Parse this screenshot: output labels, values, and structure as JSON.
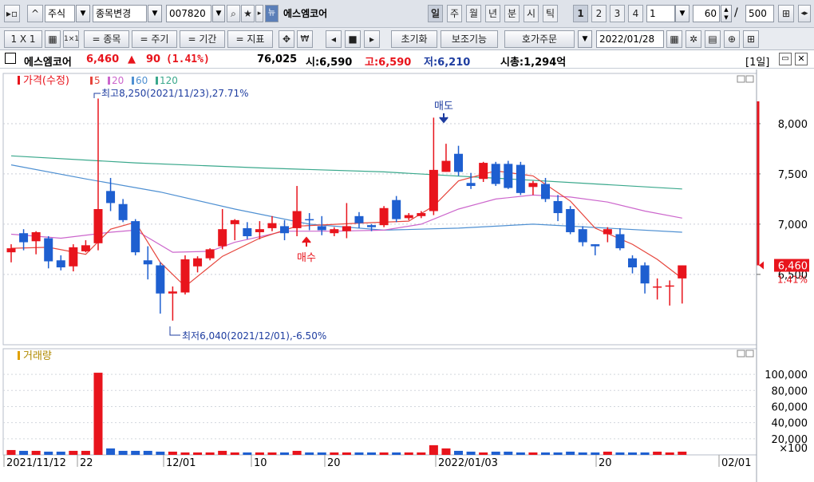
{
  "toolbar1": {
    "market": "주식",
    "change_btn": "종목변경",
    "code": "007820",
    "name": "에스엠코어",
    "periods": [
      "일",
      "주",
      "월",
      "년",
      "분",
      "시",
      "틱"
    ],
    "active_period": "일",
    "multiples": [
      "1",
      "2",
      "3",
      "4"
    ],
    "count_field": "1",
    "count": "60",
    "total": "500",
    "slash": "/"
  },
  "toolbar2": {
    "layout": "1 X 1",
    "stock_btn": "= 종목",
    "cycle_btn": "= 주기",
    "term_btn": "= 기간",
    "indicator_btn": "= 지표",
    "reset": "초기화",
    "aux": "보조기능",
    "quote": "호가주문",
    "date": "2022/01/28"
  },
  "info": {
    "name": "에스엠코어",
    "price": "6,460",
    "change_sign": "▲",
    "change": "90",
    "change_pct": "(1.41%)",
    "volume": "76,025",
    "open": "시:6,590",
    "high": "고:6,590",
    "low": "저:6,210",
    "mcap": "시총:1,294억",
    "period_label": "[1일]"
  },
  "legend": {
    "price": "가격(수정)",
    "ma": [
      "5",
      "20",
      "60",
      "120"
    ],
    "volume": "거래량"
  },
  "annotations": {
    "high": "최고8,250(2021/11/23),27.71%",
    "low": "최저6,040(2021/12/01),-6.50%",
    "sell": "매도",
    "buy": "매수"
  },
  "last_label": {
    "price": "6,460",
    "pct": "1.41%"
  },
  "colors": {
    "up": "#e8141c",
    "down": "#1e5fd0",
    "ma5": "#e6453c",
    "ma20": "#cc66cc",
    "ma60": "#4f90d2",
    "ma120": "#3aa88c",
    "text_blue": "#1e3da0"
  },
  "chart_data": {
    "type": "candlestick",
    "title": "",
    "ylabel": "",
    "ylim": [
      5800,
      8500
    ],
    "yticks": [
      8000,
      7500,
      7000,
      6500
    ],
    "x_labels": [
      "2021/11/12",
      "22",
      "12/01",
      "10",
      "20",
      "2022/01/03",
      "20",
      "02/01"
    ],
    "candles": [
      {
        "o": 6720,
        "h": 6800,
        "l": 6620,
        "c": 6760
      },
      {
        "o": 6910,
        "h": 6950,
        "l": 6740,
        "c": 6820
      },
      {
        "o": 6830,
        "h": 6930,
        "l": 6700,
        "c": 6920
      },
      {
        "o": 6860,
        "h": 6880,
        "l": 6560,
        "c": 6630
      },
      {
        "o": 6640,
        "h": 6690,
        "l": 6540,
        "c": 6570
      },
      {
        "o": 6580,
        "h": 6800,
        "l": 6530,
        "c": 6770
      },
      {
        "o": 6730,
        "h": 6840,
        "l": 6720,
        "c": 6790
      },
      {
        "o": 6810,
        "h": 8250,
        "l": 6740,
        "c": 7150
      },
      {
        "o": 7330,
        "h": 7460,
        "l": 7130,
        "c": 7210
      },
      {
        "o": 7200,
        "h": 7250,
        "l": 7020,
        "c": 7040
      },
      {
        "o": 7030,
        "h": 7050,
        "l": 6690,
        "c": 6720
      },
      {
        "o": 6640,
        "h": 6780,
        "l": 6450,
        "c": 6600
      },
      {
        "o": 6590,
        "h": 6620,
        "l": 6110,
        "c": 6310
      },
      {
        "o": 6310,
        "h": 6380,
        "l": 6040,
        "c": 6330
      },
      {
        "o": 6320,
        "h": 6690,
        "l": 6300,
        "c": 6650
      },
      {
        "o": 6580,
        "h": 6680,
        "l": 6520,
        "c": 6660
      },
      {
        "o": 6660,
        "h": 6760,
        "l": 6640,
        "c": 6750
      },
      {
        "o": 6780,
        "h": 7150,
        "l": 6750,
        "c": 6950
      },
      {
        "o": 7000,
        "h": 7050,
        "l": 6840,
        "c": 7040
      },
      {
        "o": 6960,
        "h": 7020,
        "l": 6850,
        "c": 6880
      },
      {
        "o": 6920,
        "h": 7030,
        "l": 6850,
        "c": 6950
      },
      {
        "o": 6960,
        "h": 7080,
        "l": 6930,
        "c": 7010
      },
      {
        "o": 6980,
        "h": 7040,
        "l": 6840,
        "c": 6910
      },
      {
        "o": 6960,
        "h": 7380,
        "l": 6880,
        "c": 7130
      },
      {
        "o": 7050,
        "h": 7110,
        "l": 6940,
        "c": 7040
      },
      {
        "o": 6980,
        "h": 7080,
        "l": 6890,
        "c": 6940
      },
      {
        "o": 6910,
        "h": 6970,
        "l": 6880,
        "c": 6950
      },
      {
        "o": 6930,
        "h": 7210,
        "l": 6860,
        "c": 6980
      },
      {
        "o": 7080,
        "h": 7120,
        "l": 6960,
        "c": 7010
      },
      {
        "o": 6990,
        "h": 7000,
        "l": 6930,
        "c": 6970
      },
      {
        "o": 6990,
        "h": 7180,
        "l": 6970,
        "c": 7160
      },
      {
        "o": 7240,
        "h": 7280,
        "l": 7020,
        "c": 7050
      },
      {
        "o": 7060,
        "h": 7110,
        "l": 7040,
        "c": 7090
      },
      {
        "o": 7080,
        "h": 7130,
        "l": 7060,
        "c": 7110
      },
      {
        "o": 7130,
        "h": 8060,
        "l": 7090,
        "c": 7540
      },
      {
        "o": 7520,
        "h": 7800,
        "l": 7520,
        "c": 7630
      },
      {
        "o": 7700,
        "h": 7780,
        "l": 7480,
        "c": 7520
      },
      {
        "o": 7410,
        "h": 7510,
        "l": 7350,
        "c": 7380
      },
      {
        "o": 7450,
        "h": 7620,
        "l": 7420,
        "c": 7610
      },
      {
        "o": 7600,
        "h": 7620,
        "l": 7380,
        "c": 7400
      },
      {
        "o": 7600,
        "h": 7630,
        "l": 7350,
        "c": 7360
      },
      {
        "o": 7590,
        "h": 7620,
        "l": 7290,
        "c": 7310
      },
      {
        "o": 7370,
        "h": 7430,
        "l": 7290,
        "c": 7410
      },
      {
        "o": 7400,
        "h": 7460,
        "l": 7220,
        "c": 7250
      },
      {
        "o": 7230,
        "h": 7290,
        "l": 7030,
        "c": 7110
      },
      {
        "o": 7150,
        "h": 7180,
        "l": 6900,
        "c": 6920
      },
      {
        "o": 6950,
        "h": 6980,
        "l": 6780,
        "c": 6820
      },
      {
        "o": 6800,
        "h": 6800,
        "l": 6690,
        "c": 6780
      },
      {
        "o": 6900,
        "h": 6970,
        "l": 6820,
        "c": 6950
      },
      {
        "o": 6900,
        "h": 6960,
        "l": 6740,
        "c": 6760
      },
      {
        "o": 6660,
        "h": 6690,
        "l": 6510,
        "c": 6570
      },
      {
        "o": 6590,
        "h": 6620,
        "l": 6310,
        "c": 6410
      },
      {
        "o": 6370,
        "h": 6460,
        "l": 6250,
        "c": 6380
      },
      {
        "o": 6380,
        "h": 6440,
        "l": 6190,
        "c": 6390
      },
      {
        "o": 6460,
        "h": 6590,
        "l": 6210,
        "c": 6590
      }
    ],
    "ma5": [
      [
        0,
        6760
      ],
      [
        3,
        6770
      ],
      [
        6,
        6700
      ],
      [
        8,
        6950
      ],
      [
        10,
        7020
      ],
      [
        12,
        6620
      ],
      [
        14,
        6380
      ],
      [
        17,
        6680
      ],
      [
        20,
        6860
      ],
      [
        23,
        6980
      ],
      [
        28,
        7010
      ],
      [
        32,
        7030
      ],
      [
        34,
        7180
      ],
      [
        36,
        7430
      ],
      [
        39,
        7530
      ],
      [
        42,
        7480
      ],
      [
        45,
        7230
      ],
      [
        47,
        6960
      ],
      [
        50,
        6800
      ],
      [
        52,
        6650
      ],
      [
        54,
        6460
      ]
    ],
    "ma20": [
      [
        0,
        6900
      ],
      [
        4,
        6860
      ],
      [
        8,
        6920
      ],
      [
        10,
        6940
      ],
      [
        13,
        6720
      ],
      [
        16,
        6730
      ],
      [
        18,
        6820
      ],
      [
        22,
        6930
      ],
      [
        26,
        6930
      ],
      [
        30,
        6940
      ],
      [
        33,
        7000
      ],
      [
        36,
        7150
      ],
      [
        39,
        7250
      ],
      [
        42,
        7290
      ],
      [
        45,
        7270
      ],
      [
        48,
        7220
      ],
      [
        51,
        7130
      ],
      [
        54,
        7060
      ]
    ],
    "ma60": [
      [
        0,
        7590
      ],
      [
        6,
        7450
      ],
      [
        12,
        7320
      ],
      [
        18,
        7150
      ],
      [
        24,
        7000
      ],
      [
        30,
        6940
      ],
      [
        36,
        6960
      ],
      [
        42,
        7000
      ],
      [
        48,
        6960
      ],
      [
        54,
        6920
      ]
    ],
    "ma120": [
      [
        0,
        7680
      ],
      [
        10,
        7610
      ],
      [
        20,
        7560
      ],
      [
        30,
        7520
      ],
      [
        40,
        7450
      ],
      [
        47,
        7400
      ],
      [
        54,
        7350
      ]
    ],
    "volume": {
      "ymax": 110000,
      "yticks": [
        100000,
        80000,
        60000,
        40000,
        20000
      ],
      "unit": "×100",
      "values": [
        6000,
        5000,
        5000,
        4000,
        4000,
        5000,
        5000,
        102000,
        8000,
        5000,
        5000,
        5000,
        4000,
        4000,
        3000,
        3000,
        3000,
        5000,
        3000,
        3000,
        3000,
        3000,
        3000,
        5000,
        3000,
        3000,
        3000,
        3000,
        3000,
        3000,
        3000,
        3000,
        3000,
        3000,
        12000,
        8000,
        5000,
        4000,
        3000,
        4000,
        4000,
        3000,
        3000,
        3000,
        3000,
        4000,
        3000,
        3000,
        4000,
        3000,
        3000,
        3000,
        4000,
        3000,
        4000
      ]
    }
  }
}
